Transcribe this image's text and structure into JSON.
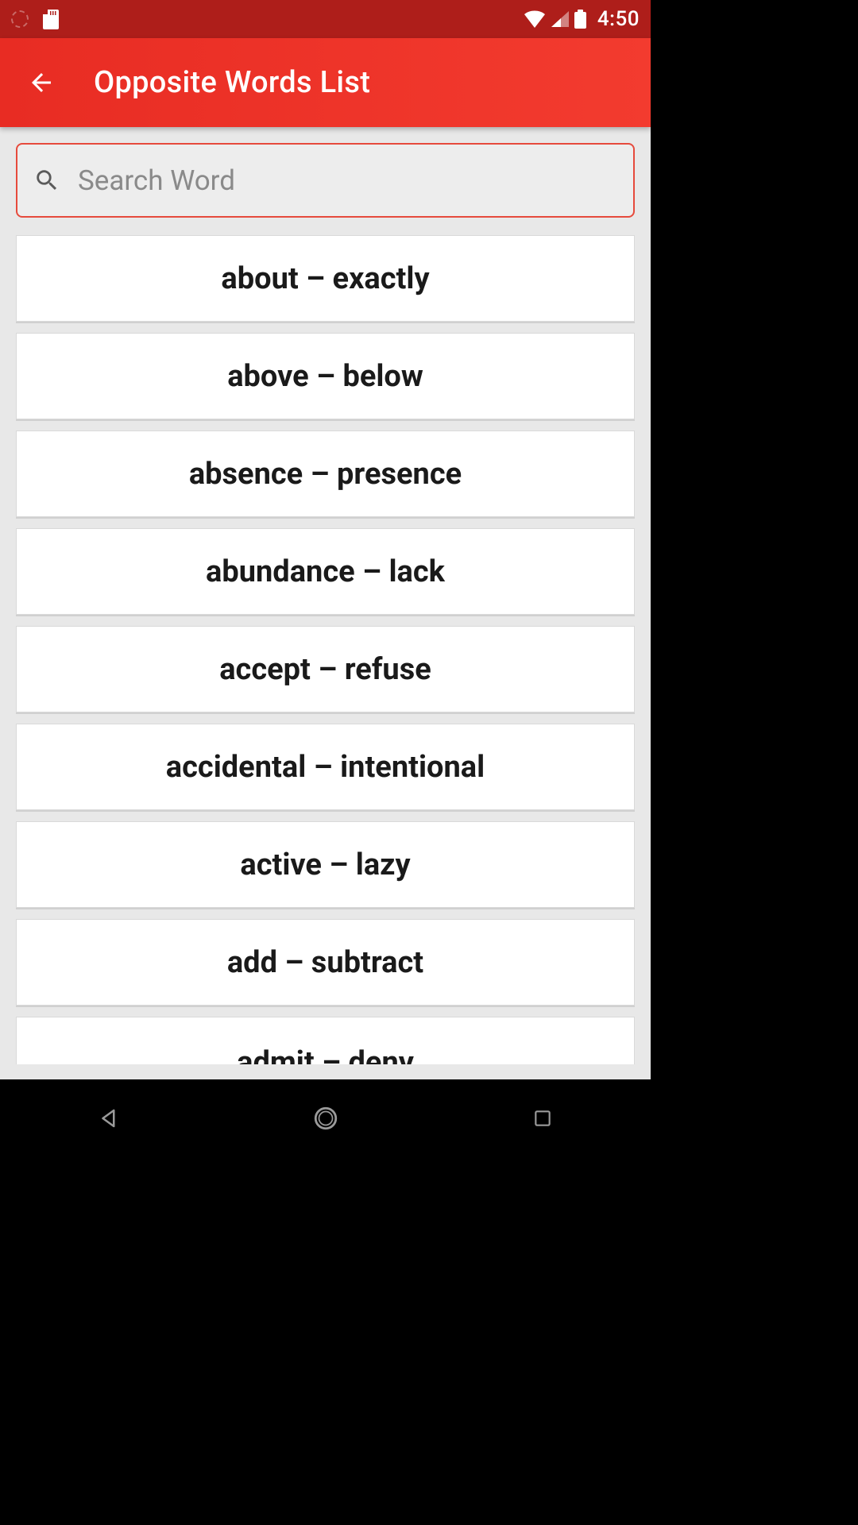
{
  "status": {
    "time": "4:50"
  },
  "appbar": {
    "title": "Opposite Words List"
  },
  "search": {
    "placeholder": "Search Word"
  },
  "words": [
    "about – exactly",
    "above – below",
    "absence – presence",
    "abundance – lack",
    "accept – refuse",
    "accidental – intentional",
    "active – lazy",
    "add – subtract",
    "admit – deny"
  ]
}
